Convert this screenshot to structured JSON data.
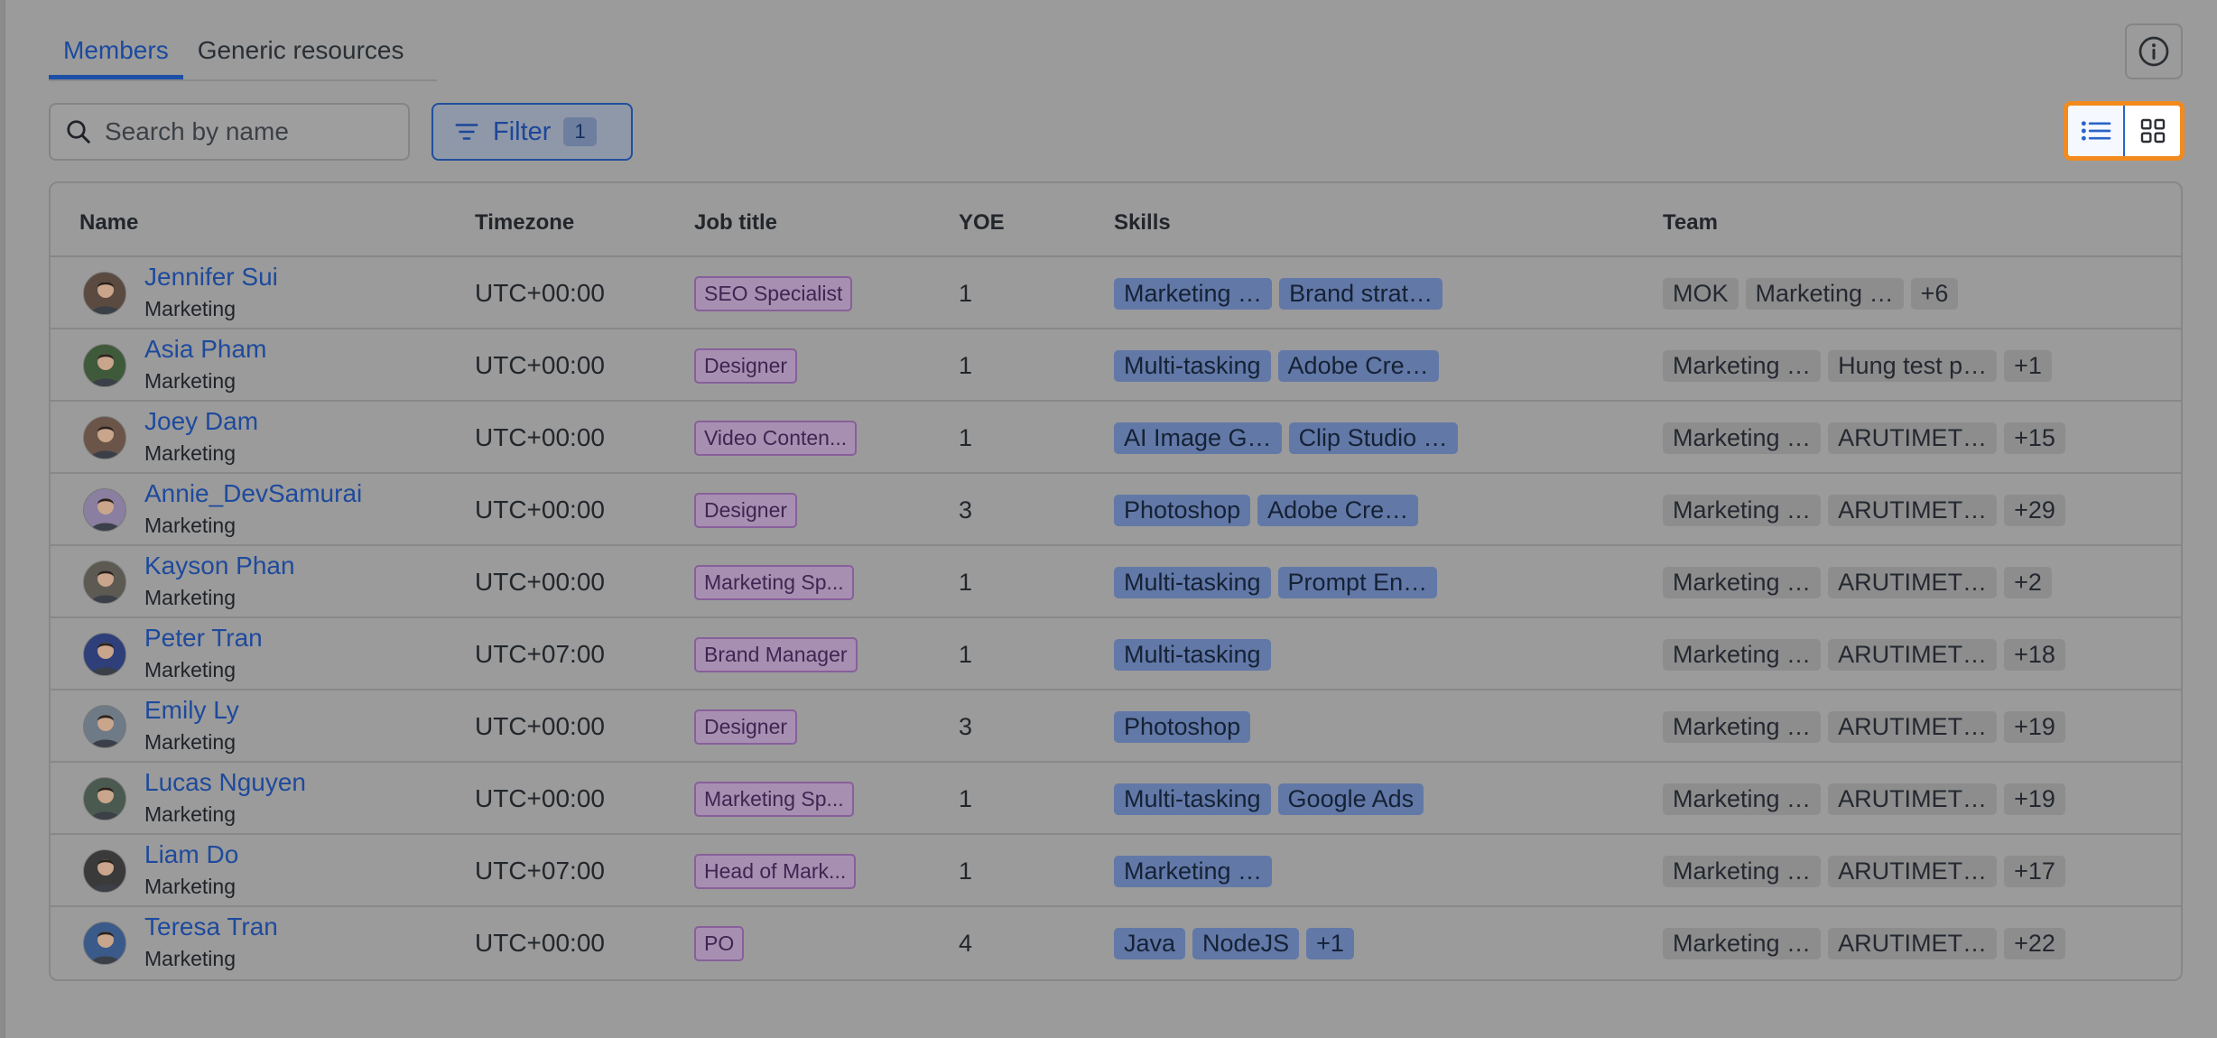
{
  "tabs": [
    {
      "label": "Members",
      "active": true
    },
    {
      "label": "Generic resources",
      "active": false
    }
  ],
  "search": {
    "placeholder": "Search by name"
  },
  "filter": {
    "label": "Filter",
    "count": "1"
  },
  "view_toggle": {
    "active": "list",
    "highlight_color": "#f28a1e"
  },
  "columns": [
    "Name",
    "Timezone",
    "Job title",
    "YOE",
    "Skills",
    "Team"
  ],
  "rows": [
    {
      "name": "Jennifer Sui",
      "dept": "Marketing",
      "tz": "UTC+00:00",
      "job": "SEO Specialist",
      "yoe": "1",
      "skills": [
        "Marketing …",
        "Brand strat…"
      ],
      "team": [
        "MOK",
        "Marketing …",
        "+6"
      ]
    },
    {
      "name": "Asia Pham",
      "dept": "Marketing",
      "tz": "UTC+00:00",
      "job": "Designer",
      "yoe": "1",
      "skills": [
        "Multi-tasking",
        "Adobe Cre…"
      ],
      "team": [
        "Marketing …",
        "Hung test p…",
        "+1"
      ]
    },
    {
      "name": "Joey Dam",
      "dept": "Marketing",
      "tz": "UTC+00:00",
      "job": "Video Conten...",
      "yoe": "1",
      "skills": [
        "AI Image G…",
        "Clip Studio …"
      ],
      "team": [
        "Marketing …",
        "ARUTIMET…",
        "+15"
      ]
    },
    {
      "name": "Annie_DevSamurai",
      "dept": "Marketing",
      "tz": "UTC+00:00",
      "job": "Designer",
      "yoe": "3",
      "skills": [
        "Photoshop",
        "Adobe Cre…"
      ],
      "team": [
        "Marketing …",
        "ARUTIMET…",
        "+29"
      ]
    },
    {
      "name": "Kayson Phan",
      "dept": "Marketing",
      "tz": "UTC+00:00",
      "job": "Marketing Sp...",
      "yoe": "1",
      "skills": [
        "Multi-tasking",
        "Prompt En…"
      ],
      "team": [
        "Marketing …",
        "ARUTIMET…",
        "+2"
      ]
    },
    {
      "name": "Peter Tran",
      "dept": "Marketing",
      "tz": "UTC+07:00",
      "job": "Brand Manager",
      "yoe": "1",
      "skills": [
        "Multi-tasking"
      ],
      "team": [
        "Marketing …",
        "ARUTIMET…",
        "+18"
      ]
    },
    {
      "name": "Emily Ly",
      "dept": "Marketing",
      "tz": "UTC+00:00",
      "job": "Designer",
      "yoe": "3",
      "skills": [
        "Photoshop"
      ],
      "team": [
        "Marketing …",
        "ARUTIMET…",
        "+19"
      ]
    },
    {
      "name": "Lucas Nguyen",
      "dept": "Marketing",
      "tz": "UTC+00:00",
      "job": "Marketing Sp...",
      "yoe": "1",
      "skills": [
        "Multi-tasking",
        "Google Ads"
      ],
      "team": [
        "Marketing …",
        "ARUTIMET…",
        "+19"
      ]
    },
    {
      "name": "Liam Do",
      "dept": "Marketing",
      "tz": "UTC+07:00",
      "job": "Head of Mark...",
      "yoe": "1",
      "skills": [
        "Marketing …"
      ],
      "team": [
        "Marketing …",
        "ARUTIMET…",
        "+17"
      ]
    },
    {
      "name": "Teresa Tran",
      "dept": "Marketing",
      "tz": "UTC+00:00",
      "job": "PO",
      "yoe": "4",
      "skills": [
        "Java",
        "NodeJS",
        "+1"
      ],
      "team": [
        "Marketing …",
        "ARUTIMET…",
        "+22"
      ]
    }
  ]
}
